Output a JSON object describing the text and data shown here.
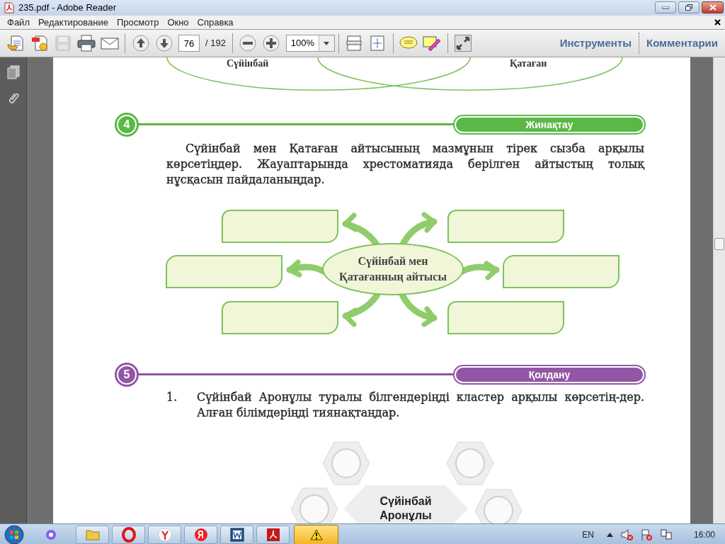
{
  "window": {
    "title": "235.pdf - Adobe Reader"
  },
  "menu": [
    "Файл",
    "Редактирование",
    "Просмотр",
    "Окно",
    "Справка"
  ],
  "toolbar": {
    "page": "76",
    "page_total": "/ 192",
    "zoom": "100%",
    "panels": [
      "Инструменты",
      "Комментарии"
    ]
  },
  "document": {
    "top_labels": [
      "Сүйінбай",
      "Қатаған"
    ],
    "sections": [
      {
        "kind": "diagram",
        "number": "4",
        "tag": "Жинақтау",
        "color": "#5bb847",
        "text": "Сүйінбай мен Қатаған айтысының мазмұнын тірек сызба арқылы көрсетіңдер. Жауаптарында хрестоматияда берілген айтыстың толық нұсқасын пайдаланыңдар.",
        "center": "Сүйінбай мен\nҚатағанның айтысы"
      },
      {
        "kind": "cluster",
        "number": "5",
        "tag": "Қолдану",
        "color": "#9157a4",
        "item_number": "1.",
        "text": "Сүйінбай Аронұлы туралы білгендеріңді кластер арқылы көрсетің-дер. Алған білімдеріңді тиянақтаңдар.",
        "center": "Сүйінбай\nАронұлы"
      }
    ]
  },
  "taskbar": {
    "language": "EN",
    "clock": "16:00"
  }
}
